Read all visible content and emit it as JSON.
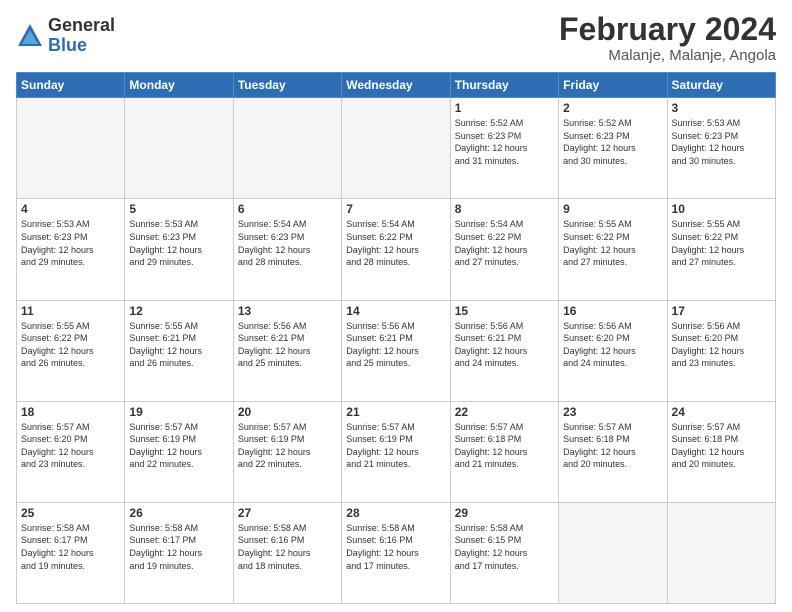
{
  "logo": {
    "general": "General",
    "blue": "Blue"
  },
  "header": {
    "title": "February 2024",
    "subtitle": "Malanje, Malanje, Angola"
  },
  "days": [
    "Sunday",
    "Monday",
    "Tuesday",
    "Wednesday",
    "Thursday",
    "Friday",
    "Saturday"
  ],
  "weeks": [
    [
      {
        "day": "",
        "info": ""
      },
      {
        "day": "",
        "info": ""
      },
      {
        "day": "",
        "info": ""
      },
      {
        "day": "",
        "info": ""
      },
      {
        "day": "1",
        "info": "Sunrise: 5:52 AM\nSunset: 6:23 PM\nDaylight: 12 hours\nand 31 minutes."
      },
      {
        "day": "2",
        "info": "Sunrise: 5:52 AM\nSunset: 6:23 PM\nDaylight: 12 hours\nand 30 minutes."
      },
      {
        "day": "3",
        "info": "Sunrise: 5:53 AM\nSunset: 6:23 PM\nDaylight: 12 hours\nand 30 minutes."
      }
    ],
    [
      {
        "day": "4",
        "info": "Sunrise: 5:53 AM\nSunset: 6:23 PM\nDaylight: 12 hours\nand 29 minutes."
      },
      {
        "day": "5",
        "info": "Sunrise: 5:53 AM\nSunset: 6:23 PM\nDaylight: 12 hours\nand 29 minutes."
      },
      {
        "day": "6",
        "info": "Sunrise: 5:54 AM\nSunset: 6:23 PM\nDaylight: 12 hours\nand 28 minutes."
      },
      {
        "day": "7",
        "info": "Sunrise: 5:54 AM\nSunset: 6:22 PM\nDaylight: 12 hours\nand 28 minutes."
      },
      {
        "day": "8",
        "info": "Sunrise: 5:54 AM\nSunset: 6:22 PM\nDaylight: 12 hours\nand 27 minutes."
      },
      {
        "day": "9",
        "info": "Sunrise: 5:55 AM\nSunset: 6:22 PM\nDaylight: 12 hours\nand 27 minutes."
      },
      {
        "day": "10",
        "info": "Sunrise: 5:55 AM\nSunset: 6:22 PM\nDaylight: 12 hours\nand 27 minutes."
      }
    ],
    [
      {
        "day": "11",
        "info": "Sunrise: 5:55 AM\nSunset: 6:22 PM\nDaylight: 12 hours\nand 26 minutes."
      },
      {
        "day": "12",
        "info": "Sunrise: 5:55 AM\nSunset: 6:21 PM\nDaylight: 12 hours\nand 26 minutes."
      },
      {
        "day": "13",
        "info": "Sunrise: 5:56 AM\nSunset: 6:21 PM\nDaylight: 12 hours\nand 25 minutes."
      },
      {
        "day": "14",
        "info": "Sunrise: 5:56 AM\nSunset: 6:21 PM\nDaylight: 12 hours\nand 25 minutes."
      },
      {
        "day": "15",
        "info": "Sunrise: 5:56 AM\nSunset: 6:21 PM\nDaylight: 12 hours\nand 24 minutes."
      },
      {
        "day": "16",
        "info": "Sunrise: 5:56 AM\nSunset: 6:20 PM\nDaylight: 12 hours\nand 24 minutes."
      },
      {
        "day": "17",
        "info": "Sunrise: 5:56 AM\nSunset: 6:20 PM\nDaylight: 12 hours\nand 23 minutes."
      }
    ],
    [
      {
        "day": "18",
        "info": "Sunrise: 5:57 AM\nSunset: 6:20 PM\nDaylight: 12 hours\nand 23 minutes."
      },
      {
        "day": "19",
        "info": "Sunrise: 5:57 AM\nSunset: 6:19 PM\nDaylight: 12 hours\nand 22 minutes."
      },
      {
        "day": "20",
        "info": "Sunrise: 5:57 AM\nSunset: 6:19 PM\nDaylight: 12 hours\nand 22 minutes."
      },
      {
        "day": "21",
        "info": "Sunrise: 5:57 AM\nSunset: 6:19 PM\nDaylight: 12 hours\nand 21 minutes."
      },
      {
        "day": "22",
        "info": "Sunrise: 5:57 AM\nSunset: 6:18 PM\nDaylight: 12 hours\nand 21 minutes."
      },
      {
        "day": "23",
        "info": "Sunrise: 5:57 AM\nSunset: 6:18 PM\nDaylight: 12 hours\nand 20 minutes."
      },
      {
        "day": "24",
        "info": "Sunrise: 5:57 AM\nSunset: 6:18 PM\nDaylight: 12 hours\nand 20 minutes."
      }
    ],
    [
      {
        "day": "25",
        "info": "Sunrise: 5:58 AM\nSunset: 6:17 PM\nDaylight: 12 hours\nand 19 minutes."
      },
      {
        "day": "26",
        "info": "Sunrise: 5:58 AM\nSunset: 6:17 PM\nDaylight: 12 hours\nand 19 minutes."
      },
      {
        "day": "27",
        "info": "Sunrise: 5:58 AM\nSunset: 6:16 PM\nDaylight: 12 hours\nand 18 minutes."
      },
      {
        "day": "28",
        "info": "Sunrise: 5:58 AM\nSunset: 6:16 PM\nDaylight: 12 hours\nand 17 minutes."
      },
      {
        "day": "29",
        "info": "Sunrise: 5:58 AM\nSunset: 6:15 PM\nDaylight: 12 hours\nand 17 minutes."
      },
      {
        "day": "",
        "info": ""
      },
      {
        "day": "",
        "info": ""
      }
    ]
  ]
}
